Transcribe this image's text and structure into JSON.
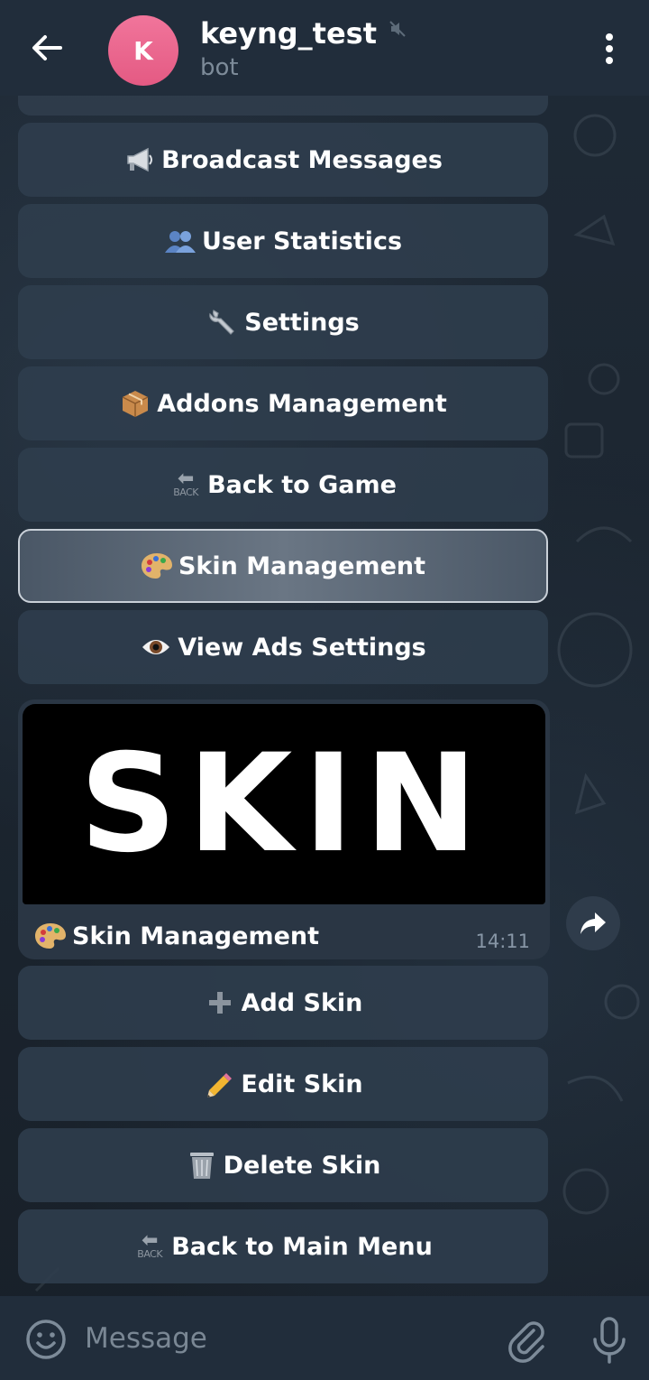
{
  "header": {
    "title": "keyng_test",
    "subtitle": "bot",
    "avatar_letter": "K",
    "icons": {
      "back": "arrow-left-icon",
      "mute": "muted-speaker-icon",
      "menu": "more-vertical-icon"
    }
  },
  "keyboard_top": [
    {
      "label": "Broadcast Messages",
      "icon": "megaphone-icon"
    },
    {
      "label": "User Statistics",
      "icon": "users-icon"
    },
    {
      "label": "Settings",
      "icon": "wrench-icon"
    },
    {
      "label": "Addons Management",
      "icon": "package-icon"
    },
    {
      "label": "Back to Game",
      "icon": "back-arrow-icon",
      "icon_text": "BACK"
    },
    {
      "label": "Skin Management",
      "icon": "palette-icon",
      "selected": true
    },
    {
      "label": "View Ads Settings",
      "icon": "eye-icon"
    }
  ],
  "message": {
    "image_text": "SKIN",
    "caption": "Skin Management",
    "time": "14:11",
    "share_icon": "forward-arrow-icon"
  },
  "keyboard_bottom": [
    {
      "label": "Add Skin",
      "icon": "plus-icon"
    },
    {
      "label": "Edit Skin",
      "icon": "pencil-icon"
    },
    {
      "label": "Delete Skin",
      "icon": "wastebasket-icon"
    },
    {
      "label": "Back to Main Menu",
      "icon": "back-arrow-icon",
      "icon_text": "BACK"
    }
  ],
  "input": {
    "placeholder": "Message",
    "icons": {
      "emoji": "smiley-icon",
      "attach": "paperclip-icon",
      "mic": "microphone-icon"
    }
  },
  "colors": {
    "header_bg": "#212d3b",
    "button_bg": "#2f3d4d",
    "avatar": "#e45a83",
    "muted_text": "#7d8b99"
  }
}
